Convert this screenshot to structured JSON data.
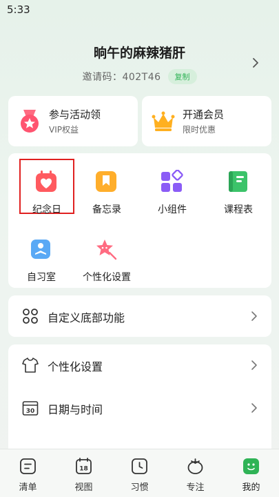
{
  "status_bar": {
    "time": "5:33"
  },
  "profile": {
    "name": "晌午的麻辣猪肝",
    "invite_code": "邀请码：402T46",
    "copy_label": "复制"
  },
  "promos": [
    {
      "title": "参与活动领",
      "subtitle": "VIP权益",
      "icon": "medal-icon"
    },
    {
      "title": "开通会员",
      "subtitle": "限时优惠",
      "icon": "crown-icon"
    }
  ],
  "tools": [
    {
      "label": "纪念日",
      "icon": "anniversary-calendar-heart-icon",
      "selected": true
    },
    {
      "label": "备忘录",
      "icon": "memo-bookmark-icon"
    },
    {
      "label": "小组件",
      "icon": "widgets-icon"
    },
    {
      "label": "课程表",
      "icon": "course-book-icon"
    },
    {
      "label": "自习室",
      "icon": "study-room-icon"
    },
    {
      "label": "个性化设置",
      "icon": "star-brush-icon"
    }
  ],
  "menu": {
    "custom_bottom": {
      "label": "自定义底部功能",
      "icon": "grid-circles-icon"
    },
    "personalize": {
      "label": "个性化设置",
      "icon": "tshirt-icon"
    },
    "datetime": {
      "label": "日期与时间",
      "icon": "calendar-30-icon"
    }
  },
  "tabs": [
    {
      "label": "清单",
      "icon": "list-icon"
    },
    {
      "label": "视图",
      "icon": "calendar-18-icon"
    },
    {
      "label": "习惯",
      "icon": "clock-icon"
    },
    {
      "label": "专注",
      "icon": "tomato-icon"
    },
    {
      "label": "我的",
      "icon": "face-icon",
      "active": true
    }
  ],
  "colors": {
    "accent_green": "#2fb356",
    "selected_outline": "#e02020",
    "card_bg": "#ffffff"
  }
}
